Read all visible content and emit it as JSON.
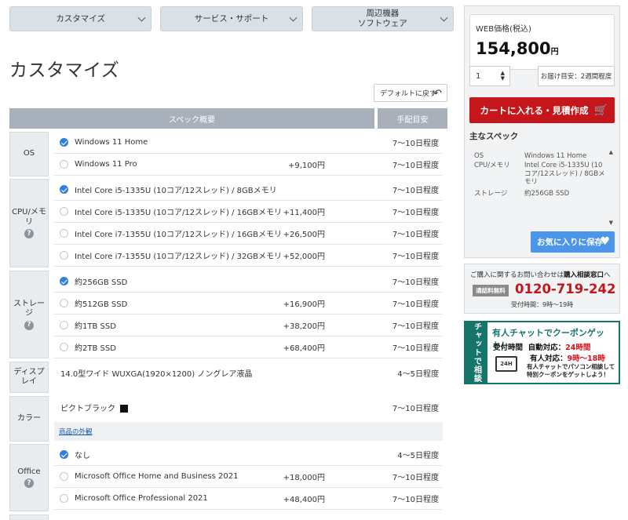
{
  "nav": [
    {
      "label": "カスタマイズ"
    },
    {
      "label": "サービス・サポート"
    },
    {
      "label": "周辺機器\nソフトウェア"
    }
  ],
  "page_title": "カスタマイズ",
  "reset_label": "デフォルトに戻す",
  "columns": {
    "spec": "スペック概要",
    "lead": "手配目安"
  },
  "sections": {
    "os": {
      "label": "OS",
      "options": [
        {
          "name": "Windows 11 Home",
          "price": "",
          "lead": "7〜10日程度",
          "selected": true
        },
        {
          "name": "Windows 11 Pro",
          "price": "+9,100円",
          "lead": "7〜10日程度",
          "selected": false
        }
      ]
    },
    "cpu": {
      "label": "CPU/メモリ",
      "options": [
        {
          "name": "Intel Core i5-1335U (10コア/12スレッド) / 8GBメモリ",
          "price": "",
          "lead": "7〜10日程度",
          "selected": true
        },
        {
          "name": "Intel Core i5-1335U (10コア/12スレッド) / 16GBメモリ",
          "price": "+11,400円",
          "lead": "7〜10日程度",
          "selected": false
        },
        {
          "name": "Intel Core i7-1355U (10コア/12スレッド) / 16GBメモリ",
          "price": "+26,500円",
          "lead": "7〜10日程度",
          "selected": false
        },
        {
          "name": "Intel Core i7-1355U (10コア/12スレッド) / 32GBメモリ",
          "price": "+52,000円",
          "lead": "7〜10日程度",
          "selected": false
        }
      ]
    },
    "storage": {
      "label": "ストレージ",
      "options": [
        {
          "name": "約256GB SSD",
          "price": "",
          "lead": "7〜10日程度",
          "selected": true
        },
        {
          "name": "約512GB SSD",
          "price": "+16,900円",
          "lead": "7〜10日程度",
          "selected": false
        },
        {
          "name": "約1TB SSD",
          "price": "+38,200円",
          "lead": "7〜10日程度",
          "selected": false
        },
        {
          "name": "約2TB SSD",
          "price": "+68,400円",
          "lead": "7〜10日程度",
          "selected": false
        }
      ]
    },
    "display": {
      "label": "ディスプレイ",
      "value": "14.0型ワイド WUXGA(1920×1200) ノングレア液晶",
      "lead": "4〜5日程度"
    },
    "color": {
      "label": "カラー",
      "value": "ピクトブラック",
      "swatch": "#111111",
      "lead": "7〜10日程度",
      "link": "商品の外観"
    },
    "office": {
      "label": "Office",
      "options": [
        {
          "name": "なし",
          "price": "",
          "lead": "4〜5日程度",
          "selected": true
        },
        {
          "name": "Microsoft Office Home and Business 2021",
          "price": "+18,000円",
          "lead": "7〜10日程度",
          "selected": false
        },
        {
          "name": "Microsoft Office Professional 2021",
          "price": "+48,400円",
          "lead": "7〜10日程度",
          "selected": false
        }
      ]
    }
  },
  "sidebar": {
    "price_label": "WEB価格(税込)",
    "price_value": "154,800",
    "price_unit": "円",
    "qty": "1",
    "delivery": "お届け目安：2週間程度",
    "cart_label": "カートに入れる・見積作成",
    "main_spec_heading": "主なスペック",
    "main_spec": [
      {
        "key": "OS",
        "value": "Windows 11 Home"
      },
      {
        "key": "CPU/メモリ",
        "value": "Intel Core i5-1335U (10コア/12スレッド) / 8GBメモリ"
      },
      {
        "key": "ストレージ",
        "value": "約256GB SSD"
      }
    ],
    "fav_label": "お気に入りに保存",
    "consult_text_pre": "ご購入に関するお問い合わせは",
    "consult_text_bold": "購入相談窓口",
    "consult_text_post": "へ",
    "free_call_badge": "通話料無料",
    "phone": "0120-719-242",
    "hours": "受付時間：9時〜19時",
    "chat_side": "チャットで相談",
    "chat_heading": "有人チャットでクーポンゲット！",
    "chat_row1_a": "受付時間",
    "chat_row1_b": "自動対応：",
    "chat_row1_c": "24時間",
    "chat_row2_a": "有人対応：",
    "chat_row2_b": "9時〜18時",
    "chat_badge": "24H",
    "chat_desc_1": "有人チャットでパソコン相談して",
    "chat_desc_2": "特別クーポンをゲットしよう！"
  },
  "colors": {
    "accent": "#2f7fe0",
    "cart": "#c5171b",
    "fav": "#4b96e8",
    "chat": "#16756a",
    "header": "#a8b1bb"
  }
}
